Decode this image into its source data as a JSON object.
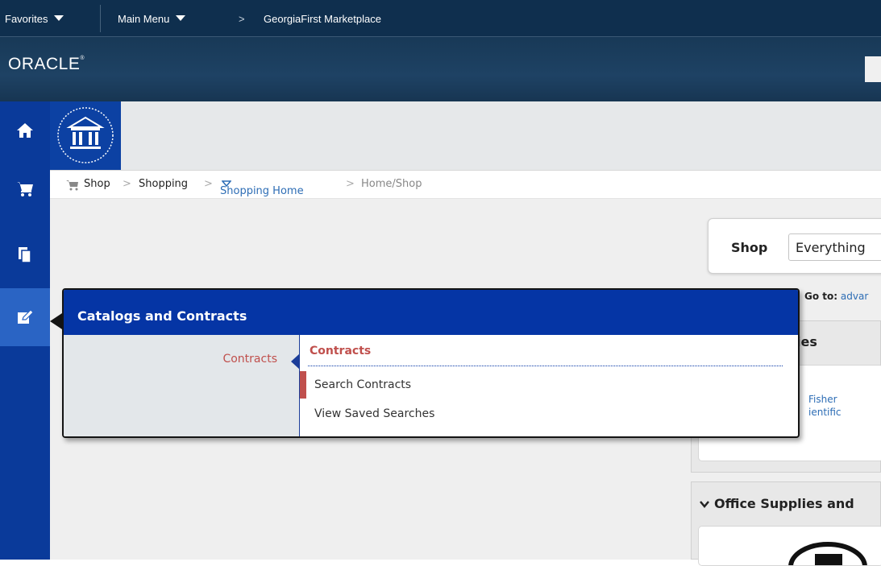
{
  "topbar": {
    "favorites": "Favorites",
    "main_menu": "Main Menu",
    "separator": ">",
    "current_page": "GeorgiaFirst Marketplace"
  },
  "brand": {
    "logo_text": "ORACLE",
    "logo_mark": "®"
  },
  "left_nav": {
    "items": [
      {
        "icon": "home-icon"
      },
      {
        "icon": "cart-icon"
      },
      {
        "icon": "documents-icon"
      },
      {
        "icon": "edit-icon",
        "active": true
      }
    ]
  },
  "breadcrumb": {
    "items": [
      "Shop",
      "Shopping",
      "Shopping Home",
      "Home/Shop"
    ],
    "separator": ">"
  },
  "shop": {
    "label": "Shop",
    "select_value": "Everything",
    "goto_label": "Go to:",
    "goto_link": "advar"
  },
  "panels": {
    "panel1_header": "ies",
    "panel1_supplier_line1": "Fisher",
    "panel1_supplier_line2": "ientific",
    "panel2_header": "Office Supplies and"
  },
  "flyout": {
    "title": "Catalogs and Contracts",
    "category": "Contracts",
    "section": "Contracts",
    "links": [
      "Search Contracts",
      "View Saved Searches"
    ]
  },
  "colors": {
    "topbar": "#0f2f4e",
    "left_nav": "#0a3a9a",
    "flyout_header": "#0535a5",
    "accent_red": "#c0504d",
    "link_blue": "#2d6db5"
  }
}
